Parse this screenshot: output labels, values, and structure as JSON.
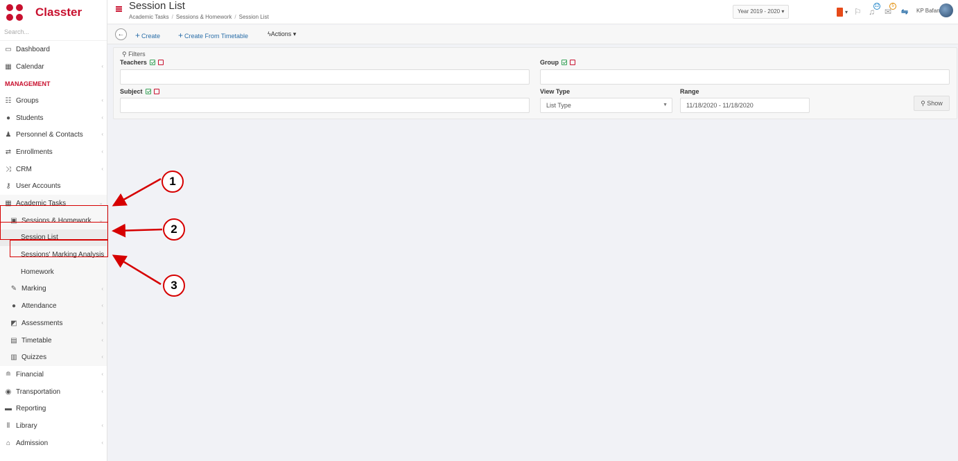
{
  "brand": {
    "name": "Classter"
  },
  "sidebar": {
    "search_placeholder": "Search...",
    "items_top": [
      {
        "label": "Dashboard",
        "icon": "laptop-icon"
      },
      {
        "label": "Calendar",
        "icon": "calendar-icon"
      }
    ],
    "section": "MANAGEMENT",
    "items": [
      {
        "label": "Groups",
        "icon": "groups-icon"
      },
      {
        "label": "Students",
        "icon": "students-icon"
      },
      {
        "label": "Personnel & Contacts",
        "icon": "personnel-icon"
      },
      {
        "label": "Enrollments",
        "icon": "enrollments-icon"
      },
      {
        "label": "CRM",
        "icon": "crm-icon"
      },
      {
        "label": "User Accounts",
        "icon": "key-icon"
      },
      {
        "label": "Academic Tasks",
        "icon": "grid-icon"
      },
      {
        "label": "Sessions & Homework",
        "icon": "sessions-icon"
      },
      {
        "label": "Session List"
      },
      {
        "label": "Sessions' Marking Analysis"
      },
      {
        "label": "Homework"
      },
      {
        "label": "Marking",
        "icon": "pencil-icon"
      },
      {
        "label": "Attendance",
        "icon": "attendance-icon"
      },
      {
        "label": "Assessments",
        "icon": "assessment-icon"
      },
      {
        "label": "Timetable",
        "icon": "timetable-icon"
      },
      {
        "label": "Quizzes",
        "icon": "quiz-icon"
      },
      {
        "label": "Financial",
        "icon": "coins-icon"
      },
      {
        "label": "Transportation",
        "icon": "bus-icon"
      },
      {
        "label": "Reporting",
        "icon": "printer-icon"
      },
      {
        "label": "Library",
        "icon": "library-icon"
      },
      {
        "label": "Admission",
        "icon": "bank-icon"
      }
    ]
  },
  "header": {
    "title": "Session List",
    "breadcrumb": [
      "Academic Tasks",
      "Sessions & Homework",
      "Session List"
    ],
    "year_selector": "Year 2019 - 2020",
    "notifications_count": "12",
    "messages_count": "5",
    "user_name": "KP Bafana"
  },
  "toolbar": {
    "create_label": "Create",
    "create_from_timetable_label": "Create From Timetable",
    "actions_label": "Actions"
  },
  "filters": {
    "legend": "Filters",
    "teachers_label": "Teachers",
    "group_label": "Group",
    "subject_label": "Subject",
    "view_type_label": "View Type",
    "view_type_value": "List Type",
    "range_label": "Range",
    "range_value": "11/18/2020 - 11/18/2020",
    "show_label": "Show"
  },
  "annotations": [
    "1",
    "2",
    "3"
  ],
  "colors": {
    "brand": "#c8102e",
    "link": "#2a6ea8",
    "annotation": "#d60000"
  }
}
